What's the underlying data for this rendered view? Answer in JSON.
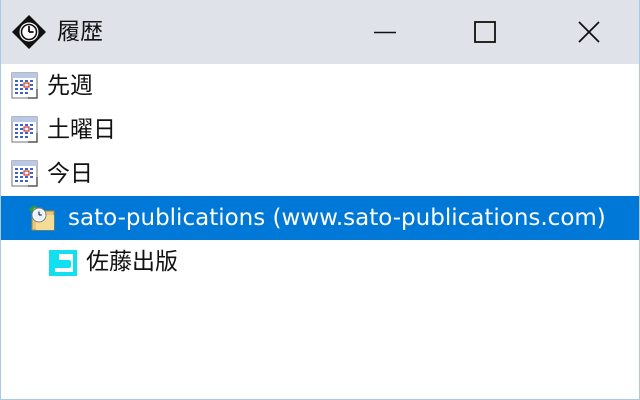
{
  "window": {
    "title": "履歴",
    "icon": "history-clock-icon",
    "controls": [
      "minimize-icon",
      "maximize-icon",
      "close-icon"
    ]
  },
  "tree": {
    "groups": [
      {
        "label": "先週",
        "icon": "calendar-icon"
      },
      {
        "label": "土曜日",
        "icon": "calendar-icon"
      },
      {
        "label": "今日",
        "icon": "calendar-icon"
      }
    ],
    "site": {
      "label": "sato-publications (www.sato-publications.com)",
      "icon": "web-folder-icon",
      "selected": true
    },
    "page": {
      "label": "佐藤出版",
      "icon": "page-icon"
    }
  },
  "colors": {
    "selection": "#0078d7",
    "titlebar": "#dfe2e8",
    "page_icon": "#12e0f0"
  }
}
